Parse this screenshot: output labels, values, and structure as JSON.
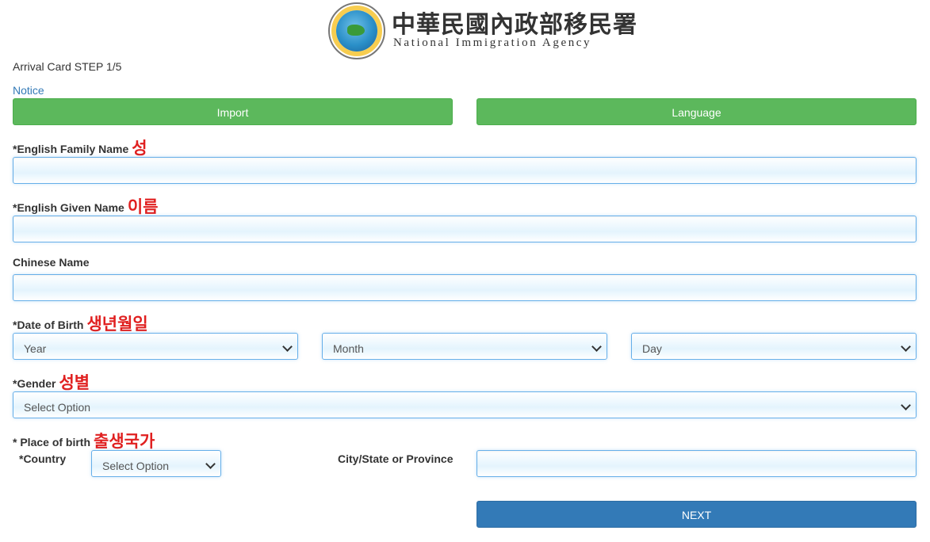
{
  "header": {
    "agency_zh": "中華民國內政部移民署",
    "agency_en": "National Immigration Agency",
    "logo_icon": "national-immigration-agency-seal"
  },
  "step_title": "Arrival Card STEP 1/5",
  "notice_link": "Notice",
  "buttons": {
    "import": "Import",
    "language": "Language",
    "next": "NEXT"
  },
  "fields": {
    "family_name": {
      "label": "*English Family Name",
      "korean": "성",
      "value": ""
    },
    "given_name": {
      "label": "*English Given Name",
      "korean": "이름",
      "value": ""
    },
    "chinese_name": {
      "label": "Chinese Name",
      "value": ""
    },
    "dob": {
      "label": "*Date of Birth",
      "korean": "생년월일",
      "year": "Year",
      "month": "Month",
      "day": "Day"
    },
    "gender": {
      "label": "*Gender",
      "korean": "성별",
      "selected": "Select Option"
    },
    "place_of_birth": {
      "label": "* Place of birth",
      "korean": "출생국가",
      "country_label": "*Country",
      "country_selected": "Select Option",
      "city_label": "City/State or Province",
      "city_value": ""
    }
  },
  "colors": {
    "green_button": "#5cb85c",
    "blue_button": "#337ab7",
    "korean_annotation": "#e02020",
    "link": "#337ab7",
    "input_border": "#66afe9"
  }
}
